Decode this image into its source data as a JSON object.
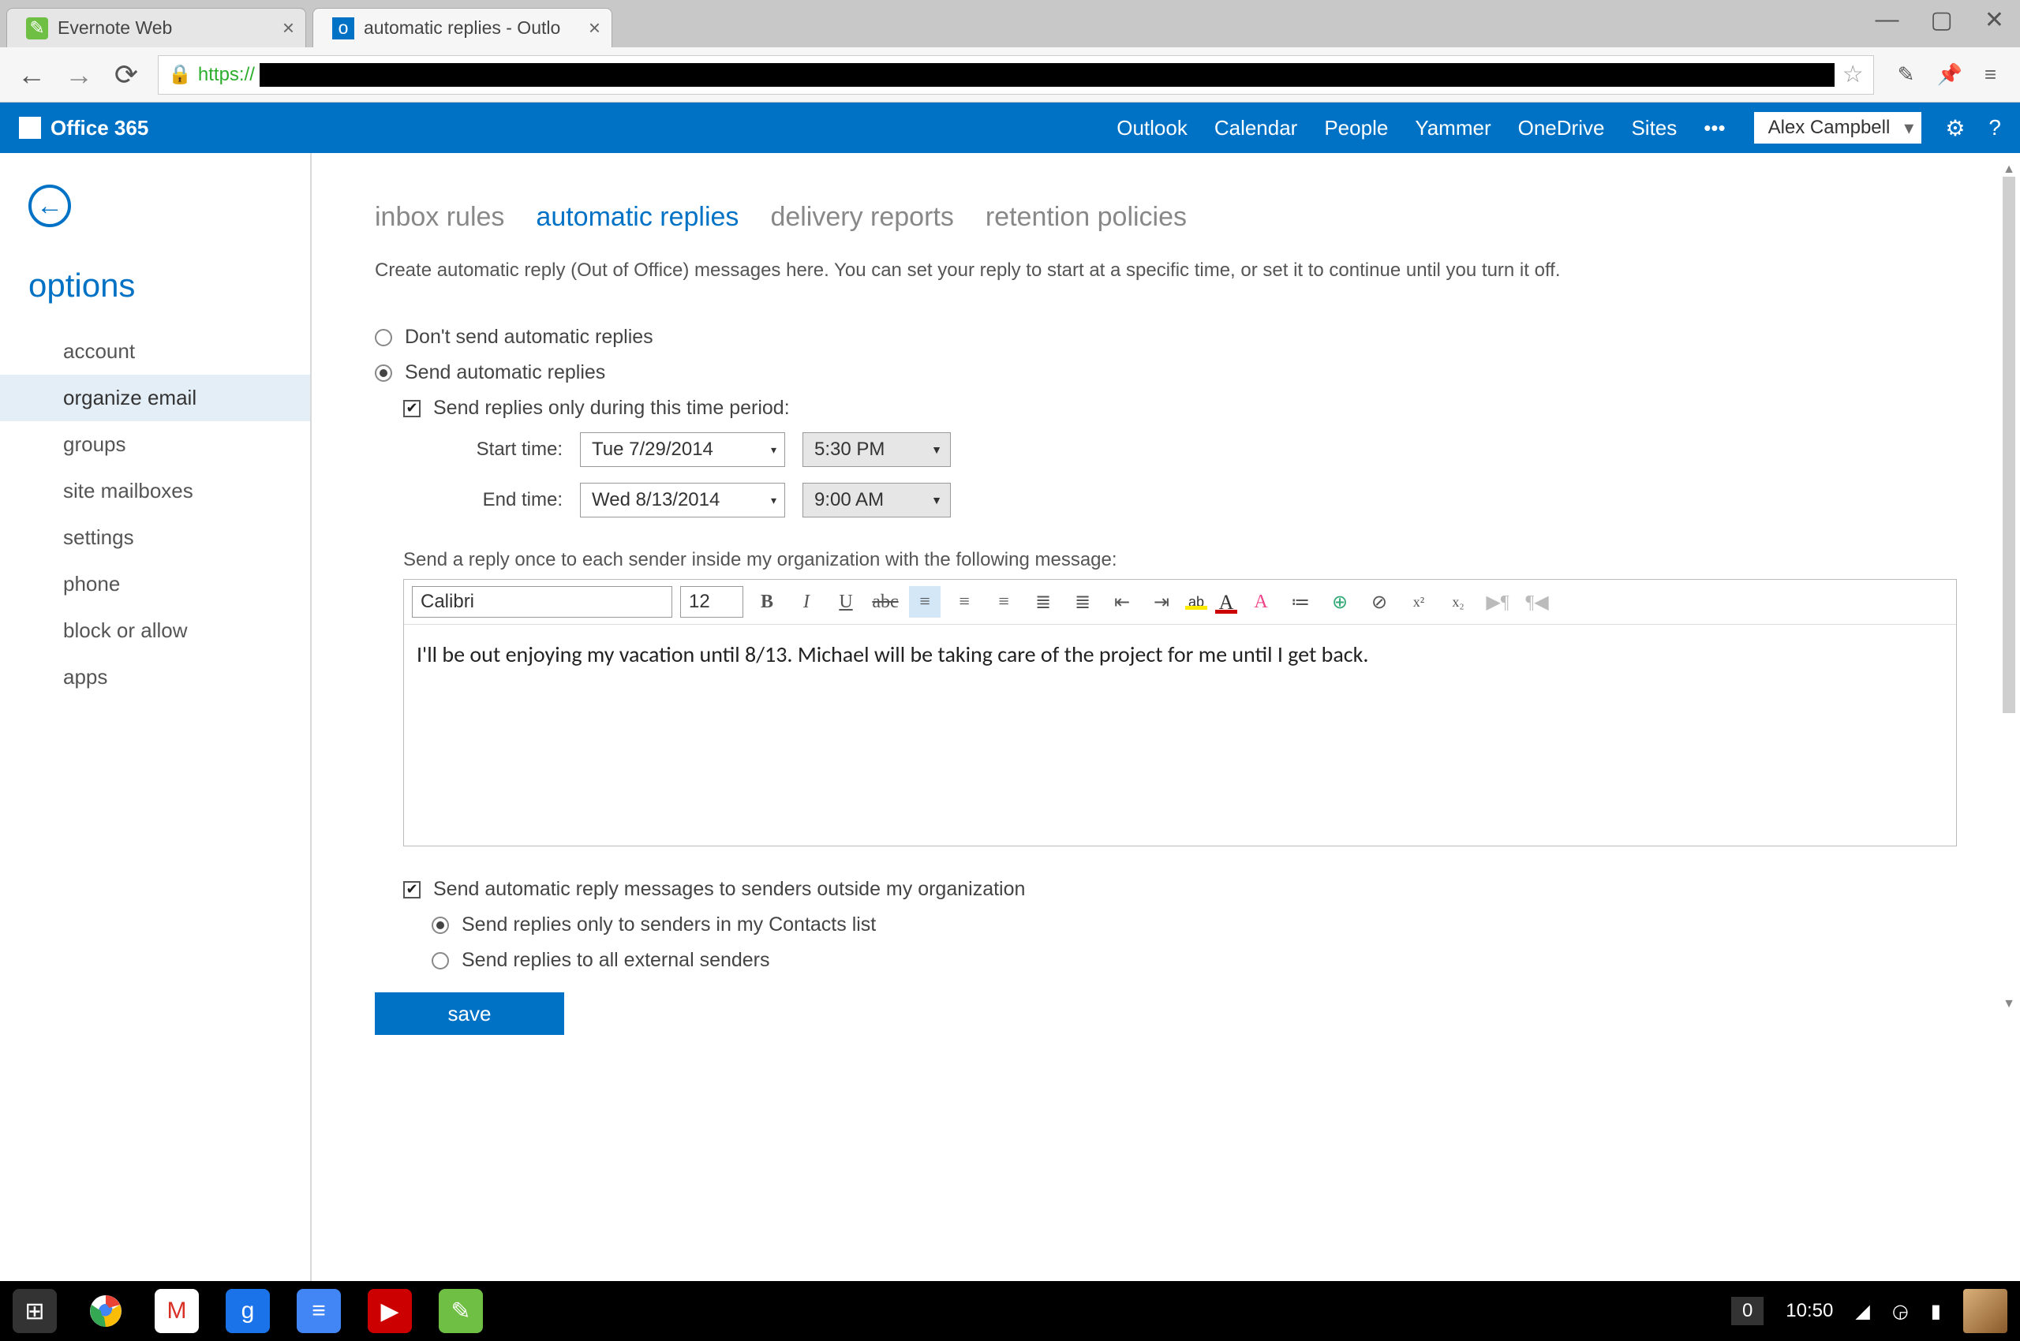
{
  "browser": {
    "tabs": [
      {
        "title": "Evernote Web",
        "active": false
      },
      {
        "title": "automatic replies - Outlo",
        "active": true
      }
    ],
    "url_scheme": "https://"
  },
  "o365": {
    "brand": "Office 365",
    "links": [
      "Outlook",
      "Calendar",
      "People",
      "Yammer",
      "OneDrive",
      "Sites"
    ],
    "user": "Alex Campbell"
  },
  "sidebar": {
    "title": "options",
    "items": [
      "account",
      "organize email",
      "groups",
      "site mailboxes",
      "settings",
      "phone",
      "block or allow",
      "apps"
    ],
    "active_index": 1
  },
  "tabs": {
    "items": [
      "inbox rules",
      "automatic replies",
      "delivery reports",
      "retention policies"
    ],
    "active_index": 1
  },
  "intro": "Create automatic reply (Out of Office) messages here. You can set your reply to start at a specific time, or set it to continue until you turn it off.",
  "form": {
    "dont_send": "Don't send automatic replies",
    "send": "Send automatic replies",
    "send_selected": true,
    "period_check_label": "Send replies only during this time period:",
    "period_checked": true,
    "start_label": "Start time:",
    "start_date": "Tue 7/29/2014",
    "start_time": "5:30 PM",
    "end_label": "End time:",
    "end_date": "Wed 8/13/2014",
    "end_time": "9:00 AM",
    "inside_label": "Send a reply once to each sender inside my organization with the following message:",
    "font_name": "Calibri",
    "font_size": "12",
    "message": "I'll be out enjoying my vacation until 8/13. Michael will be taking care of the project for me until I get back.",
    "outside_check_label": "Send automatic reply messages to senders outside my organization",
    "outside_checked": true,
    "outside_contacts": "Send replies only to senders in my Contacts list",
    "outside_all": "Send replies to all external senders",
    "outside_contacts_selected": true,
    "save": "save"
  },
  "taskbar": {
    "count": "0",
    "clock": "10:50"
  }
}
